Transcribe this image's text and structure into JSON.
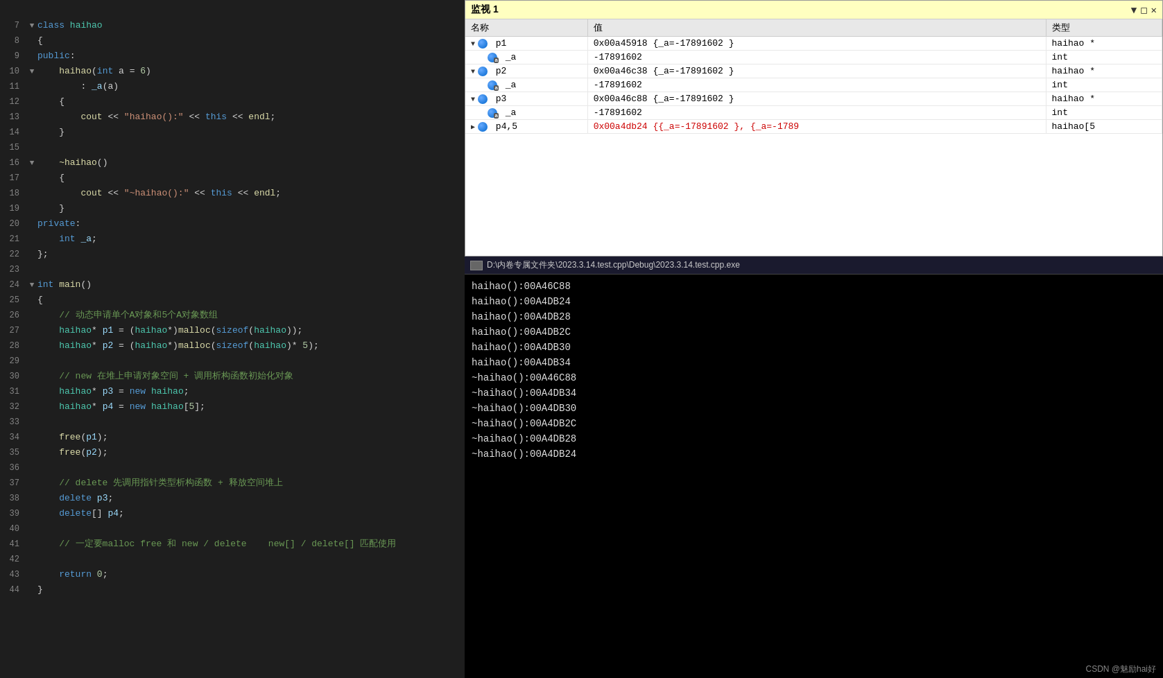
{
  "code": {
    "lines": [
      {
        "num": "",
        "indent": 0,
        "fold": "",
        "text": "",
        "tokens": []
      },
      {
        "num": "7",
        "indent": 0,
        "fold": "▼",
        "text": "class haihao",
        "tokens": [
          {
            "t": "kw",
            "v": "class"
          },
          {
            "t": "",
            "v": " "
          },
          {
            "t": "cls",
            "v": "haihao"
          }
        ]
      },
      {
        "num": "8",
        "indent": 0,
        "fold": "",
        "text": "{",
        "tokens": [
          {
            "t": "",
            "v": "{"
          }
        ]
      },
      {
        "num": "9",
        "indent": 0,
        "fold": "",
        "text": "public:",
        "tokens": [
          {
            "t": "kw",
            "v": "public"
          },
          {
            "t": "",
            "v": ":"
          }
        ]
      },
      {
        "num": "10",
        "indent": 1,
        "fold": "▼",
        "text": "    haihao(int a = 6)",
        "tokens": [
          {
            "t": "",
            "v": "    "
          },
          {
            "t": "fn",
            "v": "haihao"
          },
          {
            "t": "",
            "v": "("
          },
          {
            "t": "type",
            "v": "int"
          },
          {
            "t": "",
            "v": " a = "
          },
          {
            "t": "num",
            "v": "6"
          },
          {
            "t": "",
            "v": ")"
          }
        ]
      },
      {
        "num": "11",
        "indent": 2,
        "fold": "",
        "text": "        : _a(a)",
        "tokens": [
          {
            "t": "",
            "v": "        : "
          },
          {
            "t": "var",
            "v": "_a"
          },
          {
            "t": "",
            "v": "(a)"
          }
        ]
      },
      {
        "num": "12",
        "indent": 1,
        "fold": "",
        "text": "    {",
        "tokens": [
          {
            "t": "",
            "v": "    {"
          }
        ]
      },
      {
        "num": "13",
        "indent": 2,
        "fold": "",
        "text": "        cout << \"haihao():\" << this << endl;",
        "tokens": [
          {
            "t": "",
            "v": "        "
          },
          {
            "t": "fn",
            "v": "cout"
          },
          {
            "t": "",
            "v": " << "
          },
          {
            "t": "str",
            "v": "\"haihao():\""
          },
          {
            "t": "",
            "v": " << "
          },
          {
            "t": "kw",
            "v": "this"
          },
          {
            "t": "",
            "v": " << "
          },
          {
            "t": "fn",
            "v": "endl"
          },
          {
            "t": "",
            "v": ";"
          }
        ]
      },
      {
        "num": "14",
        "indent": 1,
        "fold": "",
        "text": "    }",
        "tokens": [
          {
            "t": "",
            "v": "    }"
          }
        ]
      },
      {
        "num": "15",
        "indent": 0,
        "fold": "",
        "text": "",
        "tokens": []
      },
      {
        "num": "16",
        "indent": 1,
        "fold": "▼",
        "text": "    ~haihao()",
        "tokens": [
          {
            "t": "",
            "v": "    "
          },
          {
            "t": "fn",
            "v": "~haihao"
          },
          {
            "t": "",
            "v": "()"
          }
        ]
      },
      {
        "num": "17",
        "indent": 1,
        "fold": "",
        "text": "    {",
        "tokens": [
          {
            "t": "",
            "v": "    {"
          }
        ]
      },
      {
        "num": "18",
        "indent": 2,
        "fold": "",
        "text": "        cout << \"~haihao():\" << this << endl;",
        "tokens": [
          {
            "t": "",
            "v": "        "
          },
          {
            "t": "fn",
            "v": "cout"
          },
          {
            "t": "",
            "v": " << "
          },
          {
            "t": "str",
            "v": "\"~haihao():\""
          },
          {
            "t": "",
            "v": " << "
          },
          {
            "t": "kw",
            "v": "this"
          },
          {
            "t": "",
            "v": " << "
          },
          {
            "t": "fn",
            "v": "endl"
          },
          {
            "t": "",
            "v": ";"
          }
        ]
      },
      {
        "num": "19",
        "indent": 1,
        "fold": "",
        "text": "    }",
        "tokens": [
          {
            "t": "",
            "v": "    }"
          }
        ]
      },
      {
        "num": "20",
        "indent": 0,
        "fold": "",
        "text": "private:",
        "tokens": [
          {
            "t": "kw",
            "v": "private"
          },
          {
            "t": "",
            "v": ":"
          }
        ]
      },
      {
        "num": "21",
        "indent": 1,
        "fold": "",
        "text": "    int _a;",
        "tokens": [
          {
            "t": "",
            "v": "    "
          },
          {
            "t": "type",
            "v": "int"
          },
          {
            "t": "",
            "v": " "
          },
          {
            "t": "var",
            "v": "_a"
          },
          {
            "t": "",
            "v": ";"
          }
        ]
      },
      {
        "num": "22",
        "indent": 0,
        "fold": "",
        "text": "};",
        "tokens": [
          {
            "t": "",
            "v": "};"
          }
        ]
      },
      {
        "num": "23",
        "indent": 0,
        "fold": "",
        "text": "",
        "tokens": []
      },
      {
        "num": "24",
        "indent": 0,
        "fold": "▼",
        "text": "int main()",
        "tokens": [
          {
            "t": "type",
            "v": "int"
          },
          {
            "t": "",
            "v": " "
          },
          {
            "t": "fn",
            "v": "main"
          },
          {
            "t": "",
            "v": "()"
          }
        ]
      },
      {
        "num": "25",
        "indent": 0,
        "fold": "",
        "text": "{",
        "tokens": [
          {
            "t": "",
            "v": "{"
          }
        ]
      },
      {
        "num": "26",
        "indent": 1,
        "fold": "",
        "text": "    // 动态申请单个A对象和5个A对象数组",
        "tokens": [
          {
            "t": "cmt",
            "v": "    // 动态申请单个A对象和5个A对象数组"
          }
        ]
      },
      {
        "num": "27",
        "indent": 1,
        "fold": "",
        "text": "    haihao* p1 = (haihao*)malloc(sizeof(haihao));",
        "tokens": [
          {
            "t": "",
            "v": "    "
          },
          {
            "t": "cls",
            "v": "haihao"
          },
          {
            "t": "",
            "v": "* "
          },
          {
            "t": "var",
            "v": "p1"
          },
          {
            "t": "",
            "v": " = ("
          },
          {
            "t": "cls",
            "v": "haihao"
          },
          {
            "t": "",
            "v": "*)"
          },
          {
            "t": "fn",
            "v": "malloc"
          },
          {
            "t": "",
            "v": "("
          },
          {
            "t": "kw",
            "v": "sizeof"
          },
          {
            "t": "",
            "v": "("
          },
          {
            "t": "cls",
            "v": "haihao"
          },
          {
            "t": "",
            "v": "));"
          }
        ]
      },
      {
        "num": "28",
        "indent": 1,
        "fold": "",
        "text": "    haihao* p2 = (haihao*)malloc(sizeof(haihao)* 5);",
        "tokens": [
          {
            "t": "",
            "v": "    "
          },
          {
            "t": "cls",
            "v": "haihao"
          },
          {
            "t": "",
            "v": "* "
          },
          {
            "t": "var",
            "v": "p2"
          },
          {
            "t": "",
            "v": " = ("
          },
          {
            "t": "cls",
            "v": "haihao"
          },
          {
            "t": "",
            "v": "*)"
          },
          {
            "t": "fn",
            "v": "malloc"
          },
          {
            "t": "",
            "v": "("
          },
          {
            "t": "kw",
            "v": "sizeof"
          },
          {
            "t": "",
            "v": "("
          },
          {
            "t": "cls",
            "v": "haihao"
          },
          {
            "t": "",
            "v": ")*"
          },
          {
            "t": "num",
            "v": " 5"
          },
          {
            "t": "",
            "v": ");"
          }
        ]
      },
      {
        "num": "29",
        "indent": 0,
        "fold": "",
        "text": "",
        "tokens": []
      },
      {
        "num": "30",
        "indent": 1,
        "fold": "",
        "text": "    // new 在堆上申请对象空间 + 调用析构函数初始化对象",
        "tokens": [
          {
            "t": "cmt",
            "v": "    // new 在堆上申请对象空间 + 调用析构函数初始化对象"
          }
        ]
      },
      {
        "num": "31",
        "indent": 1,
        "fold": "",
        "text": "    haihao* p3 = new haihao;",
        "tokens": [
          {
            "t": "",
            "v": "    "
          },
          {
            "t": "cls",
            "v": "haihao"
          },
          {
            "t": "",
            "v": "* "
          },
          {
            "t": "var",
            "v": "p3"
          },
          {
            "t": "",
            "v": " = "
          },
          {
            "t": "kw",
            "v": "new"
          },
          {
            "t": "",
            "v": " "
          },
          {
            "t": "cls",
            "v": "haihao"
          },
          {
            "t": "",
            "v": ";"
          }
        ]
      },
      {
        "num": "32",
        "indent": 1,
        "fold": "",
        "text": "    haihao* p4 = new haihao[5];",
        "tokens": [
          {
            "t": "",
            "v": "    "
          },
          {
            "t": "cls",
            "v": "haihao"
          },
          {
            "t": "",
            "v": "* "
          },
          {
            "t": "var",
            "v": "p4"
          },
          {
            "t": "",
            "v": " = "
          },
          {
            "t": "kw",
            "v": "new"
          },
          {
            "t": "",
            "v": " "
          },
          {
            "t": "cls",
            "v": "haihao"
          },
          {
            "t": "",
            "v": "["
          },
          {
            "t": "num",
            "v": "5"
          },
          {
            "t": "",
            "v": "];"
          }
        ]
      },
      {
        "num": "33",
        "indent": 0,
        "fold": "",
        "text": "",
        "tokens": []
      },
      {
        "num": "34",
        "indent": 1,
        "fold": "",
        "text": "    free(p1);",
        "tokens": [
          {
            "t": "",
            "v": "    "
          },
          {
            "t": "fn",
            "v": "free"
          },
          {
            "t": "",
            "v": "("
          },
          {
            "t": "var",
            "v": "p1"
          },
          {
            "t": "",
            "v": ");"
          }
        ]
      },
      {
        "num": "35",
        "indent": 1,
        "fold": "",
        "text": "    free(p2);",
        "tokens": [
          {
            "t": "",
            "v": "    "
          },
          {
            "t": "fn",
            "v": "free"
          },
          {
            "t": "",
            "v": "("
          },
          {
            "t": "var",
            "v": "p2"
          },
          {
            "t": "",
            "v": ");"
          }
        ]
      },
      {
        "num": "36",
        "indent": 0,
        "fold": "",
        "text": "",
        "tokens": []
      },
      {
        "num": "37",
        "indent": 1,
        "fold": "",
        "text": "    // delete 先调用指针类型析构函数 + 释放空间堆上",
        "tokens": [
          {
            "t": "cmt",
            "v": "    // delete 先调用指针类型析构函数 + 释放空间堆上"
          }
        ]
      },
      {
        "num": "38",
        "indent": 1,
        "fold": "",
        "text": "    delete p3;",
        "tokens": [
          {
            "t": "",
            "v": "    "
          },
          {
            "t": "kw",
            "v": "delete"
          },
          {
            "t": "",
            "v": " "
          },
          {
            "t": "var",
            "v": "p3"
          },
          {
            "t": "",
            "v": ";"
          }
        ]
      },
      {
        "num": "39",
        "indent": 1,
        "fold": "",
        "text": "    delete[] p4;",
        "tokens": [
          {
            "t": "",
            "v": "    "
          },
          {
            "t": "kw",
            "v": "delete"
          },
          {
            "t": "",
            "v": "[] "
          },
          {
            "t": "var",
            "v": "p4"
          },
          {
            "t": "",
            "v": ";"
          }
        ]
      },
      {
        "num": "40",
        "indent": 0,
        "fold": "",
        "text": "",
        "tokens": []
      },
      {
        "num": "41",
        "indent": 1,
        "fold": "",
        "text": "    // 一定要malloc free 和 new / delete    new[] / delete[] 匹配使用",
        "tokens": [
          {
            "t": "cmt",
            "v": "    // 一定要malloc free 和 new / delete    new[] / delete[] 匹配使用"
          }
        ]
      },
      {
        "num": "42",
        "indent": 0,
        "fold": "",
        "text": "",
        "tokens": []
      },
      {
        "num": "43",
        "indent": 1,
        "fold": "",
        "text": "    return 0;",
        "tokens": [
          {
            "t": "",
            "v": "    "
          },
          {
            "t": "kw",
            "v": "return"
          },
          {
            "t": "",
            "v": " "
          },
          {
            "t": "num",
            "v": "0"
          },
          {
            "t": "",
            "v": ";"
          }
        ]
      },
      {
        "num": "44",
        "indent": 0,
        "fold": "",
        "text": "}",
        "tokens": [
          {
            "t": "",
            "v": "}"
          }
        ]
      }
    ]
  },
  "watch": {
    "title": "监视 1",
    "columns": [
      {
        "label": "名称"
      },
      {
        "label": "值"
      },
      {
        "label": "类型"
      }
    ],
    "rows": [
      {
        "level": 0,
        "expanded": true,
        "icon": "ball",
        "name": "p1",
        "value": "0x00a45918 {_a=-17891602 }",
        "value_color": "black",
        "type": "haihao *"
      },
      {
        "level": 1,
        "expanded": false,
        "icon": "field",
        "name": "_a",
        "value": "-17891602",
        "value_color": "black",
        "type": "int"
      },
      {
        "level": 0,
        "expanded": true,
        "icon": "ball",
        "name": "p2",
        "value": "0x00a46c38 {_a=-17891602 }",
        "value_color": "black",
        "type": "haihao *"
      },
      {
        "level": 1,
        "expanded": false,
        "icon": "field",
        "name": "_a",
        "value": "-17891602",
        "value_color": "black",
        "type": "int"
      },
      {
        "level": 0,
        "expanded": true,
        "icon": "ball",
        "name": "p3",
        "value": "0x00a46c88 {_a=-17891602 }",
        "value_color": "black",
        "type": "haihao *"
      },
      {
        "level": 1,
        "expanded": false,
        "icon": "field",
        "name": "_a",
        "value": "-17891602",
        "value_color": "black",
        "type": "int"
      },
      {
        "level": 0,
        "expanded": false,
        "icon": "ball",
        "name": "p4,5",
        "value": "0x00a4db24 {{_a=-17891602 }, {_a=-1789",
        "value_color": "red",
        "type": "haihao[5"
      }
    ]
  },
  "console": {
    "title": "D:\\内卷专属文件夹\\2023.3.14.test.cpp\\Debug\\2023.3.14.test.cpp.exe",
    "lines": [
      "haihao():00A46C88",
      "haihao():00A4DB24",
      "haihao():00A4DB28",
      "haihao():00A4DB2C",
      "haihao():00A4DB30",
      "haihao():00A4DB34",
      "~haihao():00A46C88",
      "~haihao():00A4DB34",
      "~haihao():00A4DB30",
      "~haihao():00A4DB2C",
      "~haihao():00A4DB28",
      "~haihao():00A4DB24"
    ],
    "watermark": "CSDN @魅励hai好"
  }
}
